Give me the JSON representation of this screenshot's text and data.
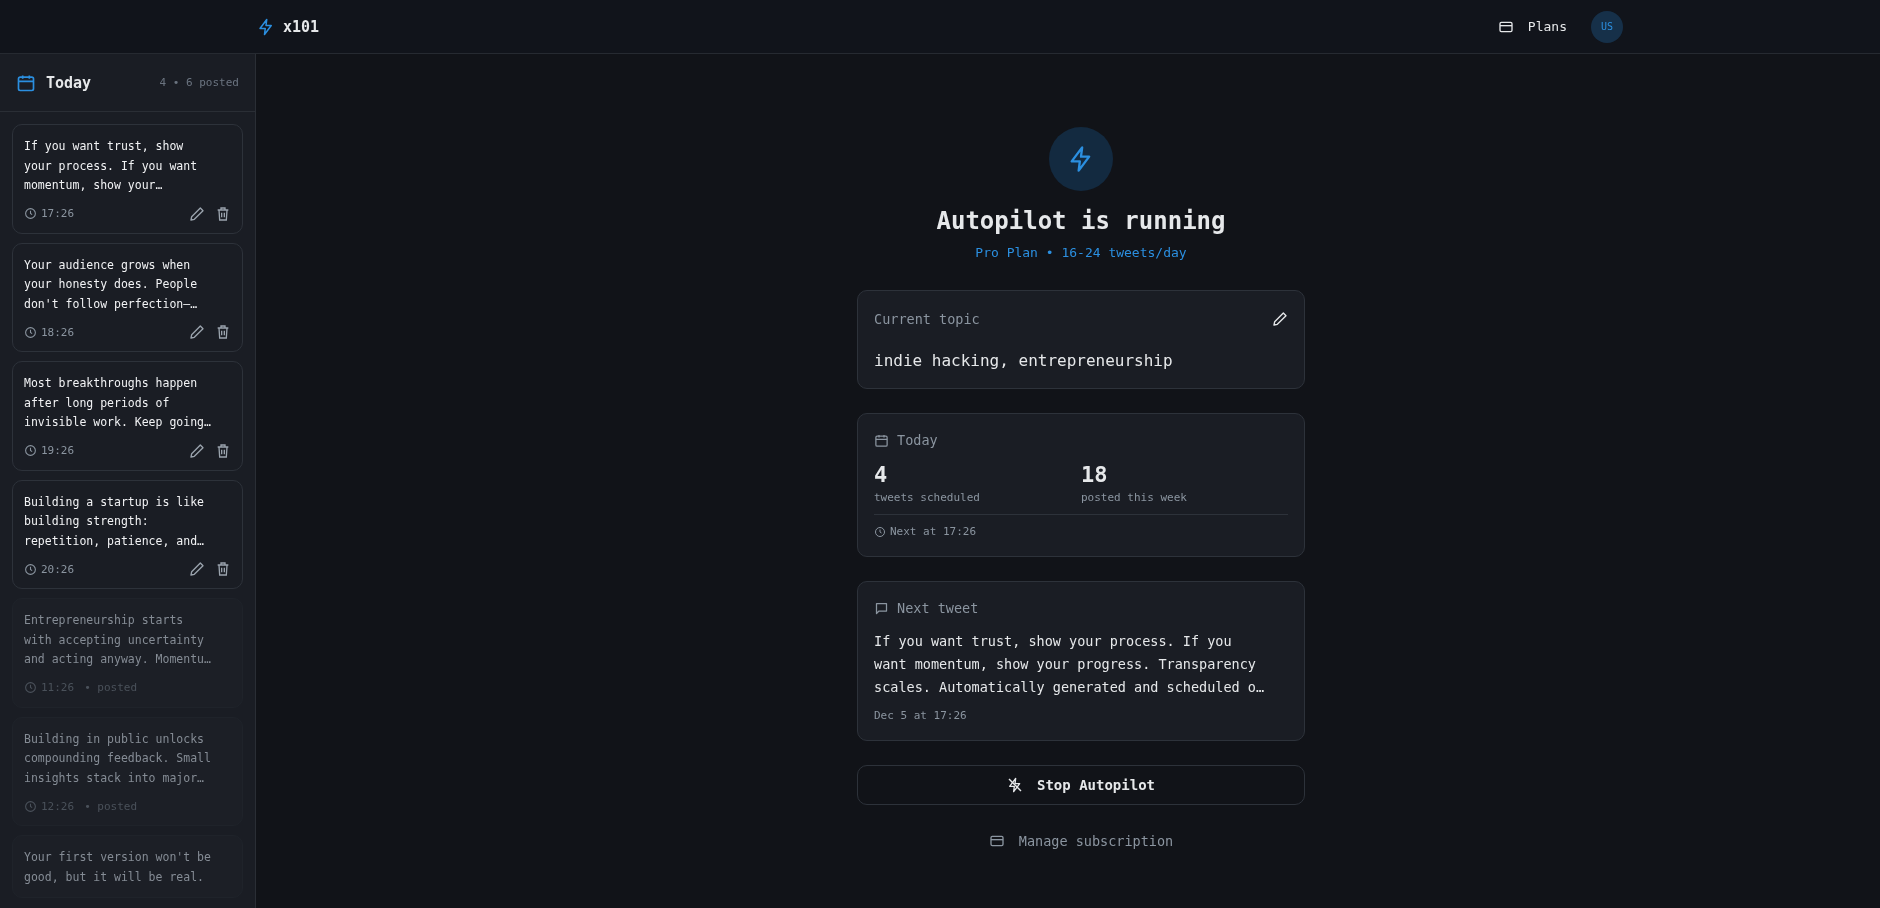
{
  "header": {
    "logo": "x101",
    "plans": "Plans",
    "avatar": "US"
  },
  "sidebar": {
    "title": "Today",
    "count": "4 • 6 posted",
    "items": [
      {
        "text": "If you want trust, show your process. If you want momentum, show your…",
        "time": "17:26",
        "posted": false
      },
      {
        "text": "Your audience grows when your honesty does. People don't follow perfection—…",
        "time": "18:26",
        "posted": false
      },
      {
        "text": "Most breakthroughs happen after long periods of invisible work. Keep going…",
        "time": "19:26",
        "posted": false
      },
      {
        "text": "Building a startup is like building strength: repetition, patience, and…",
        "time": "20:26",
        "posted": false
      },
      {
        "text": "Entrepreneurship starts with accepting uncertainty and acting anyway. Momentu…",
        "time": "11:26",
        "posted": true,
        "status": "• posted"
      },
      {
        "text": "Building in public unlocks compounding feedback. Small insights stack into major…",
        "time": "12:26",
        "posted": true,
        "status": "• posted"
      },
      {
        "text": "Your first version won't be good, but it will be real.",
        "posted": true
      }
    ]
  },
  "main": {
    "title": "Autopilot is running",
    "subtitle": "Pro Plan • 16-24 tweets/day",
    "topic": {
      "label": "Current topic",
      "value": "indie hacking, entrepreneurship"
    },
    "today": {
      "label": "Today",
      "stats": [
        {
          "value": "4",
          "label": "tweets scheduled"
        },
        {
          "value": "18",
          "label": "posted this week"
        }
      ],
      "next": "Next at 17:26"
    },
    "next_tweet": {
      "label": "Next tweet",
      "text": "If you want trust, show your process. If you want momentum, show your progress. Transparency scales. Automatically generated and scheduled o…",
      "date": "Dec 5 at 17:26"
    },
    "stop_button": "Stop Autopilot",
    "manage": "Manage subscription"
  }
}
